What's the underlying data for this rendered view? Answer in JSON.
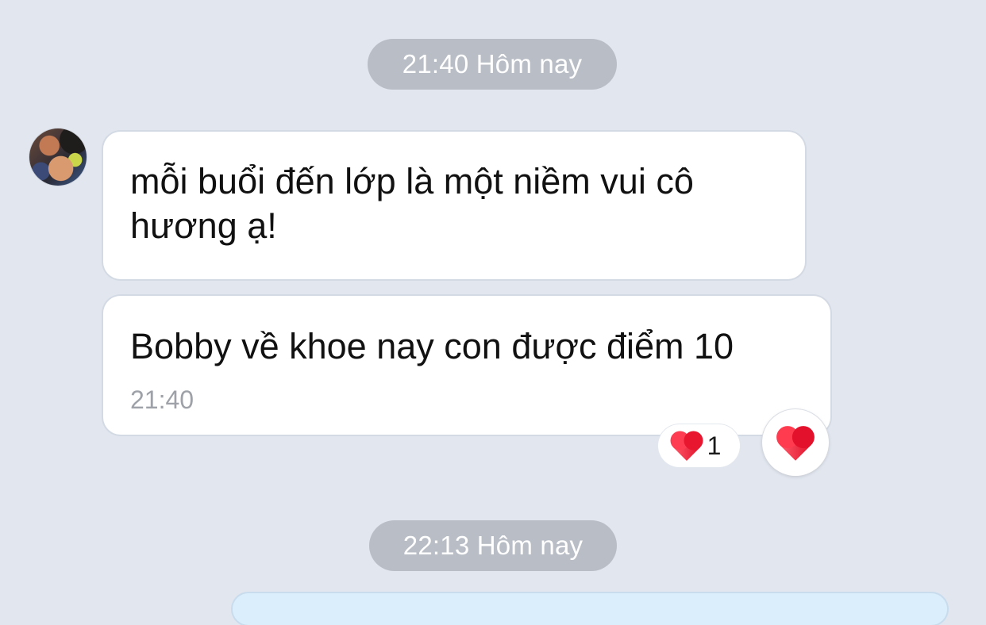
{
  "date_separators": [
    {
      "label": "21:40 Hôm nay"
    },
    {
      "label": "22:13 Hôm nay"
    }
  ],
  "messages": [
    {
      "text": "mỗi buổi đến lớp là một niềm vui cô hương ạ!",
      "time": ""
    },
    {
      "text": "Bobby về khoe nay con được điểm 10",
      "time": "21:40"
    }
  ],
  "reactions": {
    "summary_icon": "heart-icon",
    "count": "1",
    "react_button_icon": "heart-icon"
  },
  "colors": {
    "background": "#e1e6ef",
    "pill": "#b9bec6",
    "bubble": "#ffffff",
    "heart": "#e8162f",
    "outgoing_bubble": "#dbeefb"
  }
}
